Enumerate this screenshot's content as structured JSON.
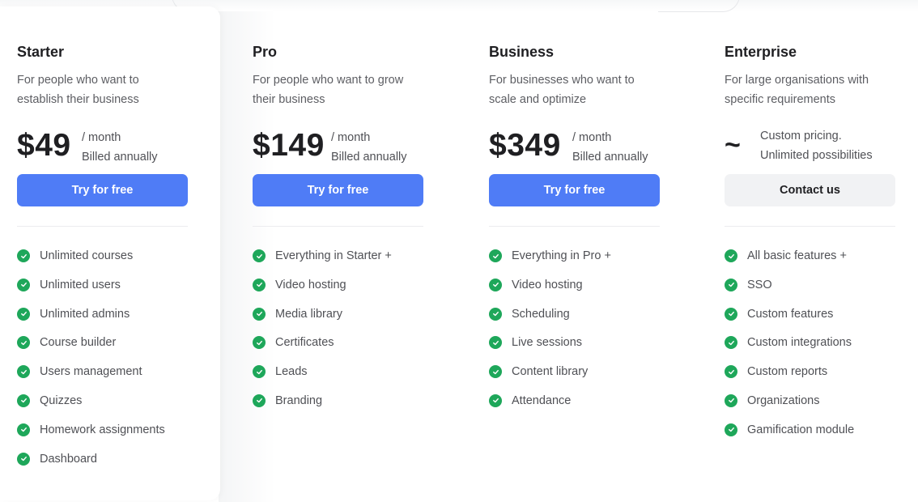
{
  "plans": [
    {
      "name": "Starter",
      "description": "For people who want to establish their business",
      "price": "$49",
      "period": "/ month",
      "billing": "Billed annually",
      "button": "Try for free",
      "features": [
        "Unlimited courses",
        "Unlimited users",
        "Unlimited admins",
        "Course builder",
        "Users management",
        "Quizzes",
        "Homework assignments",
        "Dashboard"
      ]
    },
    {
      "name": "Pro",
      "description": "For people who want to grow their business",
      "price": "$149",
      "period": "/ month",
      "billing": "Billed annually",
      "button": "Try for free",
      "features": [
        "Everything in Starter +",
        "Video hosting",
        "Media library",
        "Certificates",
        "Leads",
        "Branding"
      ]
    },
    {
      "name": "Business",
      "description": "For businesses who want to scale and optimize",
      "price": "$349",
      "period": "/ month",
      "billing": "Billed annually",
      "button": "Try for free",
      "features": [
        "Everything in Pro +",
        "Video hosting",
        "Scheduling",
        "Live sessions",
        "Content library",
        "Attendance"
      ]
    },
    {
      "name": "Enterprise",
      "description": "For large organisations with specific requirements",
      "price_symbol": "~",
      "pricing_line1": "Custom pricing.",
      "pricing_line2": "Unlimited possibilities",
      "button": "Contact us",
      "features": [
        "All basic features +",
        "SSO",
        "Custom features",
        "Custom integrations",
        "Custom reports",
        "Organizations",
        "Gamification module"
      ]
    }
  ],
  "icons": {
    "feature_check": "check-circle-icon"
  },
  "colors": {
    "primary_button": "#4f7cf6",
    "secondary_button": "#f1f2f4",
    "check": "#1ea75a"
  }
}
